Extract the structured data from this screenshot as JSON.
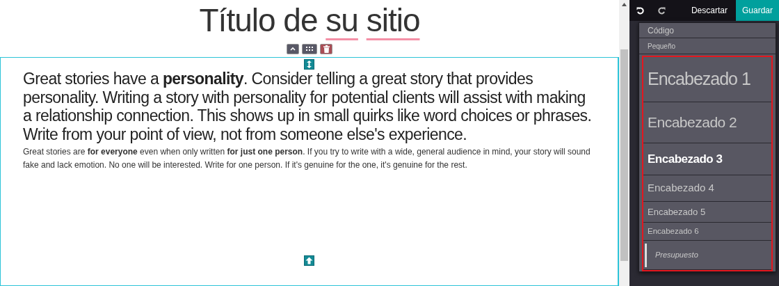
{
  "title": [
    {
      "text": "Título de",
      "misspelled": false
    },
    {
      "text": "su",
      "misspelled": true
    },
    {
      "text": "sitio",
      "misspelled": true
    }
  ],
  "block_toolbar": [
    {
      "kind": "up"
    },
    {
      "kind": "grid"
    },
    {
      "kind": "delete"
    }
  ],
  "lead": "Great stories have a **personality**. Consider telling a great story that provides personality. Writing a story with personality for potential clients will assist with making a relationship connection. This shows up in small quirks like word choices or phrases. Write from your point of view, not from someone else's experience.",
  "body": "Great stories are **for everyone** even when only written **for just one person**. If you try to write with a wide, general audience in mind, your story will sound fake and lack emotion. No one will be interested. Write for one person. If it's genuine for the one, it's genuine for the rest.",
  "editor_bar": {
    "discard": "Descartar",
    "save": "Guardar"
  },
  "style_menu": [
    {
      "kind": "code",
      "label": "Código",
      "selected": false
    },
    {
      "kind": "small",
      "label": "Pequeño",
      "selected": false
    }
  ],
  "highlighted_styles": [
    {
      "kind": "h1",
      "label": "Encabezado 1",
      "selected": false
    },
    {
      "kind": "h2",
      "label": "Encabezado 2",
      "selected": false
    },
    {
      "kind": "h3",
      "label": "Encabezado 3",
      "selected": true
    },
    {
      "kind": "h4",
      "label": "Encabezado 4",
      "selected": false
    },
    {
      "kind": "h5",
      "label": "Encabezado 5",
      "selected": false
    },
    {
      "kind": "h6",
      "label": "Encabezado 6",
      "selected": false
    },
    {
      "kind": "quote",
      "label": "Presupuesto",
      "selected": false
    }
  ]
}
